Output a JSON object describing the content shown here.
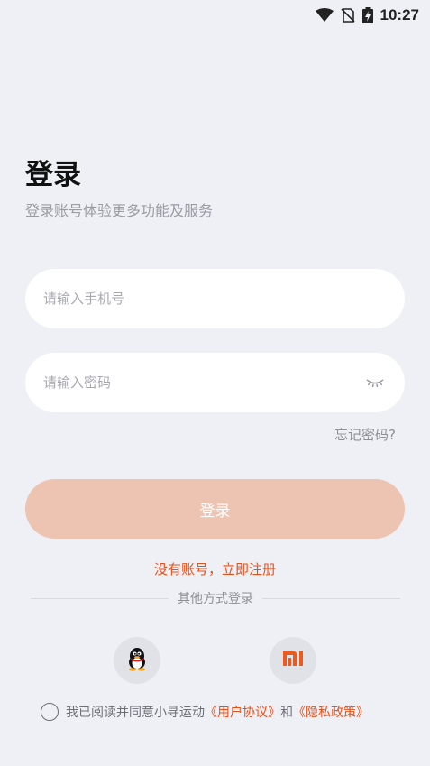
{
  "status_bar": {
    "time": "10:27"
  },
  "login": {
    "title": "登录",
    "subtitle": "登录账号体验更多功能及服务",
    "phone_placeholder": "请输入手机号",
    "password_placeholder": "请输入密码",
    "forgot_password": "忘记密码?",
    "login_button": "登录",
    "register_link": "没有账号，立即注册",
    "other_methods": "其他方式登录"
  },
  "agreement": {
    "prefix": "我已阅读并同意小寻运动",
    "user_agreement": "《用户协议》",
    "conjunction": "和",
    "privacy_policy": "《隐私政策》"
  },
  "colors": {
    "background": "#eff0f5",
    "accent": "#e6501a",
    "login_button": "#edc3b2"
  },
  "icons": {
    "social": [
      "qq-icon",
      "mi-icon"
    ],
    "password_toggle": "eye-closed-icon"
  }
}
